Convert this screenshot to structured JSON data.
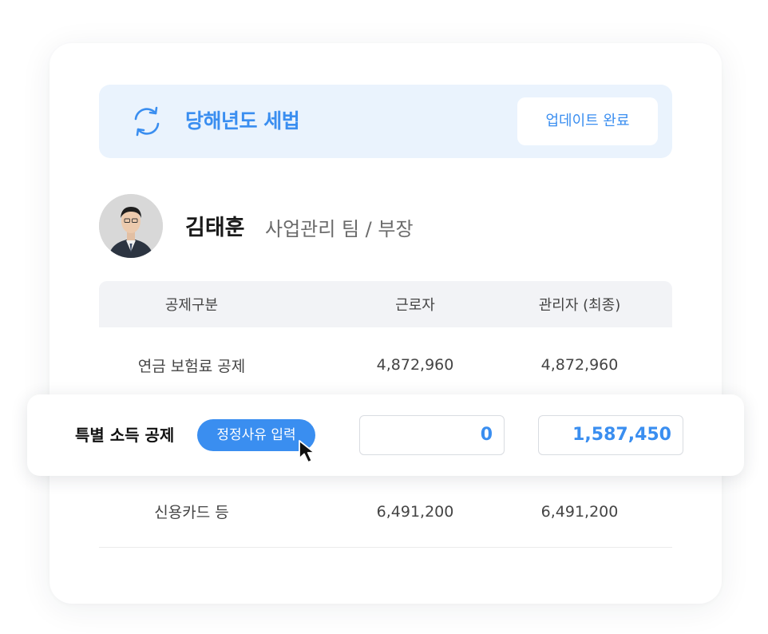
{
  "banner": {
    "icon": "refresh-icon",
    "title": "당해년도 세법",
    "status_button": "업데이트 완료"
  },
  "profile": {
    "name": "김태훈",
    "role": "사업관리 팀 / 부장"
  },
  "table": {
    "headers": [
      "공제구분",
      "근로자",
      "관리자 (최종)"
    ],
    "rows": [
      {
        "category": "연금 보험료 공제",
        "employee": "4,872,960",
        "manager": "4,872,960"
      },
      {
        "category": "특별 소득 공제",
        "reason_button": "정정사유 입력",
        "employee_input": "0",
        "manager_input": "1,587,450"
      },
      {
        "category": "신용카드 등",
        "employee": "6,491,200",
        "manager": "6,491,200"
      }
    ]
  },
  "colors": {
    "accent": "#3a8ef0",
    "banner_bg": "#eaf3fd",
    "header_bg": "#f2f3f6"
  }
}
